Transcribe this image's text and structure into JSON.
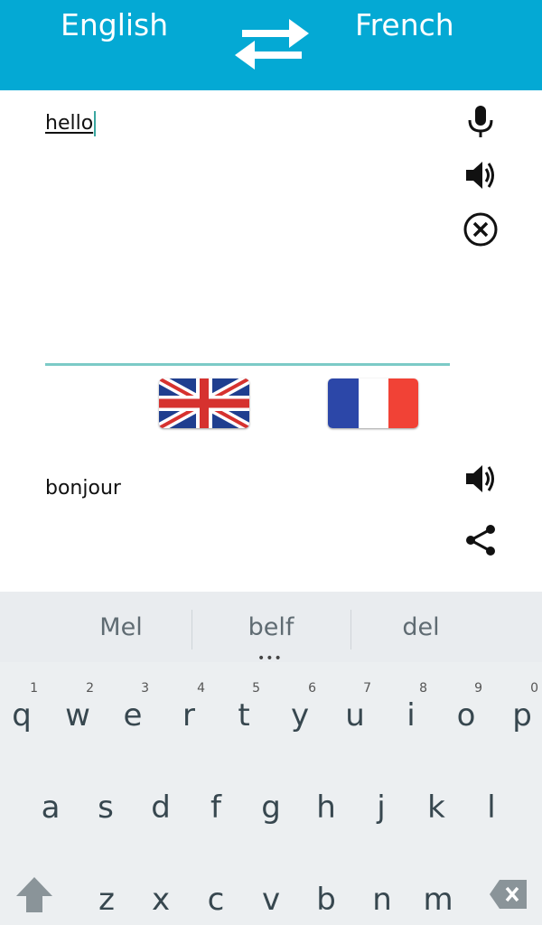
{
  "header": {
    "source_language": "English",
    "target_language": "French",
    "swap_icon": "swap-arrows-icon",
    "bg_color": "#04a9d4"
  },
  "input": {
    "text": "hello",
    "icons": [
      "microphone-icon",
      "speaker-icon",
      "clear-circle-icon"
    ]
  },
  "flags": [
    "uk-flag",
    "france-flag"
  ],
  "output": {
    "text": "bonjour",
    "icons": [
      "speaker-icon",
      "share-icon"
    ]
  },
  "keyboard": {
    "suggestions": [
      "Mel",
      "belf",
      "del"
    ],
    "more_indicator": "•••",
    "row1": [
      {
        "ch": "q",
        "num": "1"
      },
      {
        "ch": "w",
        "num": "2"
      },
      {
        "ch": "e",
        "num": "3"
      },
      {
        "ch": "r",
        "num": "4"
      },
      {
        "ch": "t",
        "num": "5"
      },
      {
        "ch": "y",
        "num": "6"
      },
      {
        "ch": "u",
        "num": "7"
      },
      {
        "ch": "i",
        "num": "8"
      },
      {
        "ch": "o",
        "num": "9"
      },
      {
        "ch": "p",
        "num": "0"
      }
    ],
    "row2": [
      "a",
      "s",
      "d",
      "f",
      "g",
      "h",
      "j",
      "k",
      "l"
    ],
    "row3": [
      "z",
      "x",
      "c",
      "v",
      "b",
      "n",
      "m"
    ],
    "shift_icon": "shift-arrow-icon",
    "backspace_icon": "backspace-icon"
  }
}
